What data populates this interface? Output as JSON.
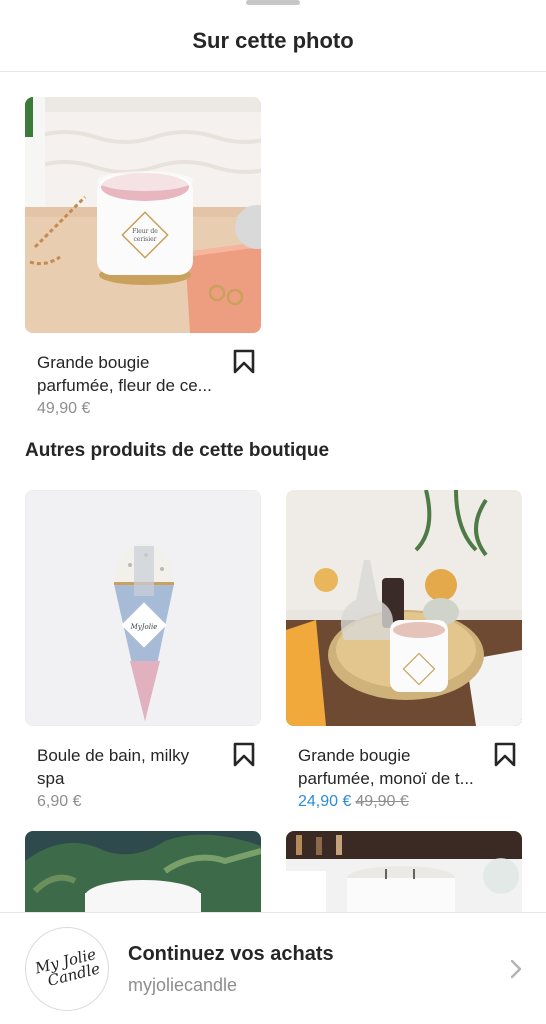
{
  "header": {
    "title": "Sur cette photo"
  },
  "main_product": {
    "name": "Grande bougie parfumée, fleur de ce...",
    "price": "49,90 €"
  },
  "section": {
    "title": "Autres produits de cette boutique"
  },
  "other_products": [
    {
      "name": "Boule de bain, milky spa",
      "price": "6,90 €"
    },
    {
      "name": "Grande bougie parfumée, monoï de t...",
      "sale_price": "24,90 €",
      "old_price": "49,90 €"
    }
  ],
  "footer": {
    "title": "Continuez vos achats",
    "subtitle": "myjoliecandle",
    "logo_text": "My Jolie Candle"
  },
  "colors": {
    "sale_price": "#2b8bd4",
    "muted": "#8e8e8e",
    "text": "#262626"
  },
  "icons": [
    "bookmark-icon",
    "chevron-right-icon"
  ]
}
